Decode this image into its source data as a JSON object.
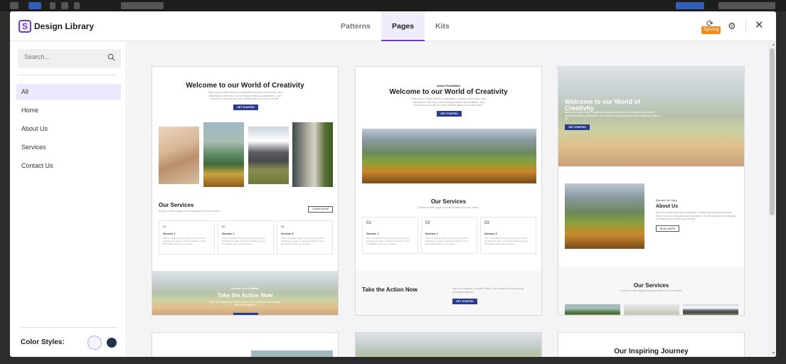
{
  "modal": {
    "title": "Design Library",
    "logo_letter": "S",
    "tabs": [
      {
        "label": "Patterns"
      },
      {
        "label": "Pages"
      },
      {
        "label": "Kits"
      }
    ],
    "active_tab": "Pages",
    "sync_badge": "Syncing",
    "sync_icon": "sync-icon",
    "settings_icon": "gear-icon",
    "close_icon": "close-icon"
  },
  "sidebar": {
    "search_placeholder": "Search...",
    "items": [
      {
        "label": "All"
      },
      {
        "label": "Home"
      },
      {
        "label": "About Us"
      },
      {
        "label": "Services"
      },
      {
        "label": "Contact Us"
      }
    ],
    "active_item": "All",
    "color_styles_label": "Color Styles:",
    "color_swatches": [
      "#f6f3fc",
      "#23304e"
    ]
  },
  "cards": [
    {
      "heading": "Welcome to our World of Creativity",
      "intro": "Step into a realm where imagination knows no bounds, and creativity is the key to unlocking endless possibilities. Our world is a canvas for your wildest ideas to come to life.",
      "cta": "GET STARTED",
      "services_title": "Our Services",
      "services_sub": "Explore a wide range of services tailored to your needs.",
      "learn_more": "LEARN MORE",
      "services": [
        {
          "num": "01",
          "title": "Service 1",
          "desc": "This is a flexible section where you can share anything you want. It could be details or some information about your services."
        },
        {
          "num": "02",
          "title": "Service 2",
          "desc": "This is a flexible section where you can share anything you want. It could be details or some information about your services."
        },
        {
          "num": "03",
          "title": "Service 3",
          "desc": "This is a flexible section where you can share anything you want. It could be details or some information about your services."
        }
      ],
      "banner_kicker": "Unleash Your Creativity",
      "banner_title": "Take the Action Now",
      "banner_desc": "Join us in shaping a brighter future. Let's embark on this exciting adventure together."
    },
    {
      "kicker": "Unlock Possibilities",
      "heading": "Welcome to our World of Creativity",
      "intro": "Step into a realm where imagination knows no bounds, and creativity is the key to unlocking endless possibilities. Our world is a canvas for your wildest ideas to come to life.",
      "cta": "GET STARTED",
      "services_title": "Our Services",
      "services_sub": "Explore a wide range of services tailored to your needs.",
      "services": [
        {
          "num": "01",
          "title": "Service 1",
          "desc": "This is a flexible section where you can share anything you want. It could be details or some information about your services."
        },
        {
          "num": "02",
          "title": "Service 2",
          "desc": "This is a flexible section where you can share anything you want. It could be details or some information about your services."
        },
        {
          "num": "03",
          "title": "Service 3",
          "desc": "This is a flexible section where you can share anything you want. It could be details or some information about your services."
        }
      ],
      "action_title": "Take the Action Now",
      "action_desc": "Join us in shaping a brighter future. Let's embark on this exciting adventure together.",
      "action_cta": "GET STARTED"
    },
    {
      "heading": "Welcome to our World of Creativity",
      "intro": "Step into a realm where imagination knows no bounds, and creativity is the key to unlocking endless possibilities. Our world is a canvas for your wildest ideas to come to life.",
      "cta": "GET STARTED",
      "about_kicker": "Discover Our Story",
      "about_title": "About Us",
      "about_desc": "We are a passionate team dedicated to delivering exceptional results. With a focus on innovation and excellence, we are committed to helping you achieve your goals and dreams.",
      "read_more": "READ MORE",
      "services_title": "Our Services",
      "services_sub": "Explore a wide range of services tailored to your needs."
    },
    {},
    {},
    {
      "heading": "Our Inspiring Journey"
    }
  ]
}
